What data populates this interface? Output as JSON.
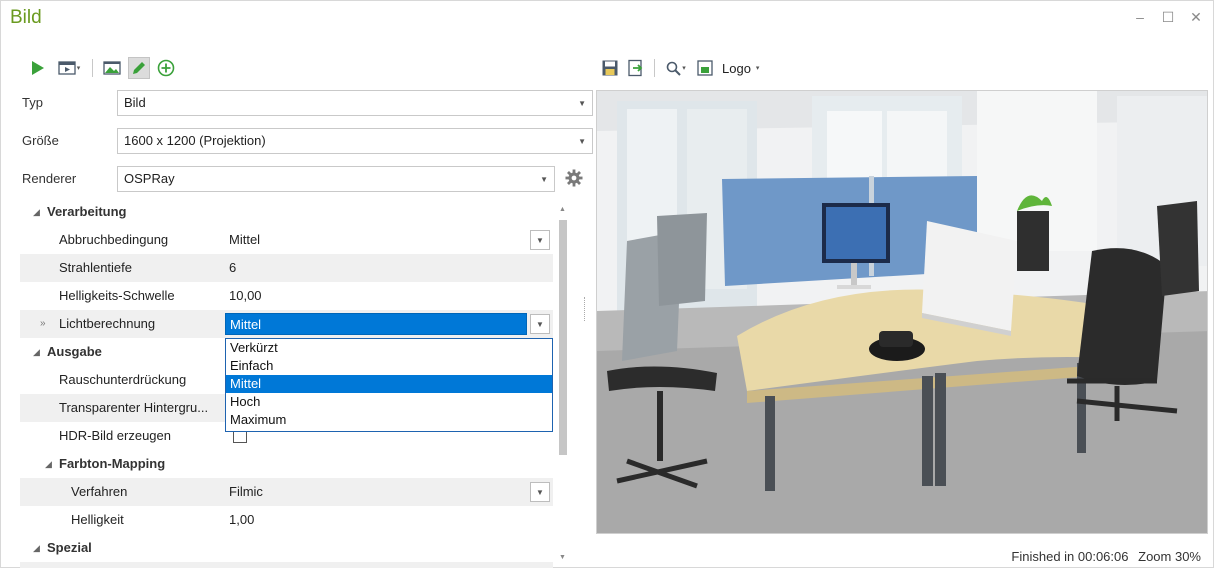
{
  "window": {
    "title": "Bild",
    "controls": {
      "minimize": "–",
      "maximize": "☐",
      "close": "✕"
    }
  },
  "toolbar_left": {
    "icons": [
      "play-icon",
      "preview-settings-icon",
      "image-icon",
      "pencil-icon",
      "add-circle-icon"
    ]
  },
  "header_fields": [
    {
      "label": "Typ",
      "value": "Bild"
    },
    {
      "label": "Größe",
      "value": "1600 x 1200 (Projektion)"
    },
    {
      "label": "Renderer",
      "value": "OSPRay"
    }
  ],
  "grid": {
    "verarbeitung": {
      "title": "Verarbeitung",
      "rows": [
        {
          "label": "Abbruchbedingung",
          "value": "Mittel"
        },
        {
          "label": "Strahlentiefe",
          "value": "6"
        },
        {
          "label": "Helligkeits-Schwelle",
          "value": "10,00"
        },
        {
          "label": "Lichtberechnung",
          "value": "Mittel",
          "marker": "»"
        }
      ]
    },
    "ausgabe": {
      "title": "Ausgabe",
      "rows": [
        {
          "label": "Rauschunterdrückung",
          "value": ""
        },
        {
          "label": "Transparenter Hintergru...",
          "value": ""
        },
        {
          "label": "HDR-Bild erzeugen",
          "checked": false
        }
      ]
    },
    "farbton": {
      "title": "Farbton-Mapping",
      "rows": [
        {
          "label": "Verfahren",
          "value": "Filmic"
        },
        {
          "label": "Helligkeit",
          "value": "1,00"
        }
      ]
    },
    "spezial": {
      "title": "Spezial"
    }
  },
  "dropdown": {
    "options": [
      "Verkürzt",
      "Einfach",
      "Mittel",
      "Hoch",
      "Maximum"
    ],
    "selected": "Mittel"
  },
  "toolbar_right": {
    "icons": [
      "save-icon",
      "export-icon",
      "zoom-icon",
      "logo-icon"
    ],
    "logo_label": "Logo"
  },
  "status": {
    "text": "Finished in 00:06:06",
    "zoom": "Zoom 30%"
  },
  "colors": {
    "accent_green": "#6a9a1f",
    "selection_blue": "#0078d7"
  }
}
